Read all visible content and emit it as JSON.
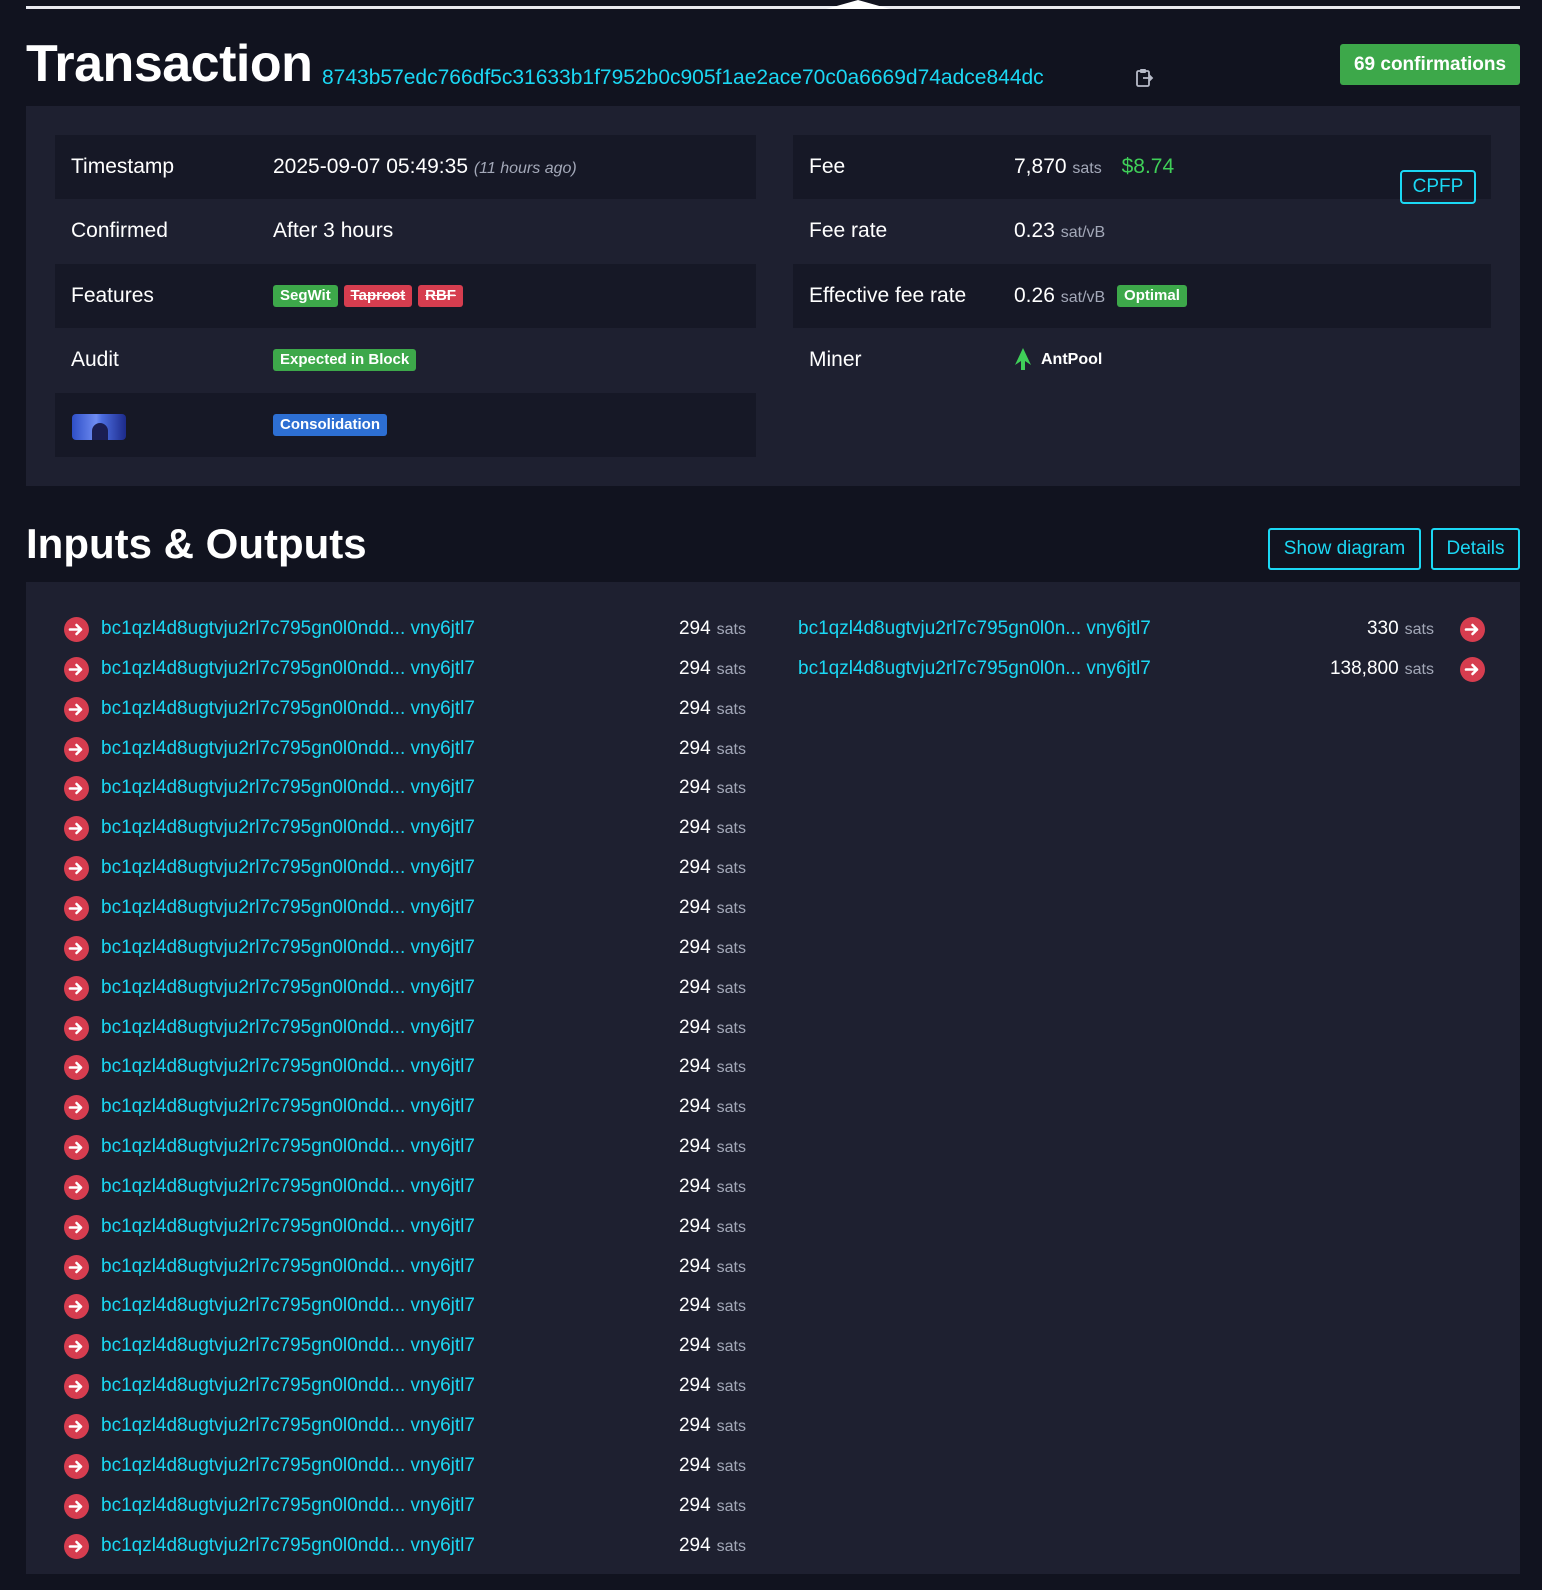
{
  "header": {
    "title": "Transaction",
    "txid": "8743b57edc766df5c31633b1f7952b0c905f1ae2ace70c0a6669d74adce844dc",
    "confirmations": "69 confirmations"
  },
  "left_details": {
    "timestamp": {
      "label": "Timestamp",
      "value": "2025-09-07 05:49:35",
      "relative": "(11 hours ago)"
    },
    "confirmed": {
      "label": "Confirmed",
      "value": "After 3 hours"
    },
    "features": {
      "label": "Features",
      "tags": [
        "SegWit",
        "Taproot",
        "RBF"
      ]
    },
    "audit": {
      "label": "Audit",
      "tag": "Expected in Block"
    },
    "classification": {
      "tag": "Consolidation"
    }
  },
  "right_details": {
    "fee": {
      "label": "Fee",
      "value": "7,870",
      "unit": "sats",
      "usd": "$8.74"
    },
    "fee_rate": {
      "label": "Fee rate",
      "value": "0.23",
      "unit": "sat/vB"
    },
    "effective_fee_rate": {
      "label": "Effective fee rate",
      "value": "0.26",
      "unit": "sat/vB",
      "tag": "Optimal",
      "button": "CPFP"
    },
    "miner": {
      "label": "Miner",
      "value": "AntPool"
    }
  },
  "io": {
    "title": "Inputs & Outputs",
    "show_diagram_label": "Show diagram",
    "details_label": "Details",
    "inputs": [
      {
        "address": "bc1qzl4d8ugtvju2rl7c795gn0l0ndd... vny6jtl7",
        "amount": "294",
        "unit": "sats"
      },
      {
        "address": "bc1qzl4d8ugtvju2rl7c795gn0l0ndd... vny6jtl7",
        "amount": "294",
        "unit": "sats"
      },
      {
        "address": "bc1qzl4d8ugtvju2rl7c795gn0l0ndd... vny6jtl7",
        "amount": "294",
        "unit": "sats"
      },
      {
        "address": "bc1qzl4d8ugtvju2rl7c795gn0l0ndd... vny6jtl7",
        "amount": "294",
        "unit": "sats"
      },
      {
        "address": "bc1qzl4d8ugtvju2rl7c795gn0l0ndd... vny6jtl7",
        "amount": "294",
        "unit": "sats"
      },
      {
        "address": "bc1qzl4d8ugtvju2rl7c795gn0l0ndd... vny6jtl7",
        "amount": "294",
        "unit": "sats"
      },
      {
        "address": "bc1qzl4d8ugtvju2rl7c795gn0l0ndd... vny6jtl7",
        "amount": "294",
        "unit": "sats"
      },
      {
        "address": "bc1qzl4d8ugtvju2rl7c795gn0l0ndd... vny6jtl7",
        "amount": "294",
        "unit": "sats"
      },
      {
        "address": "bc1qzl4d8ugtvju2rl7c795gn0l0ndd... vny6jtl7",
        "amount": "294",
        "unit": "sats"
      },
      {
        "address": "bc1qzl4d8ugtvju2rl7c795gn0l0ndd... vny6jtl7",
        "amount": "294",
        "unit": "sats"
      },
      {
        "address": "bc1qzl4d8ugtvju2rl7c795gn0l0ndd... vny6jtl7",
        "amount": "294",
        "unit": "sats"
      },
      {
        "address": "bc1qzl4d8ugtvju2rl7c795gn0l0ndd... vny6jtl7",
        "amount": "294",
        "unit": "sats"
      },
      {
        "address": "bc1qzl4d8ugtvju2rl7c795gn0l0ndd... vny6jtl7",
        "amount": "294",
        "unit": "sats"
      },
      {
        "address": "bc1qzl4d8ugtvju2rl7c795gn0l0ndd... vny6jtl7",
        "amount": "294",
        "unit": "sats"
      },
      {
        "address": "bc1qzl4d8ugtvju2rl7c795gn0l0ndd... vny6jtl7",
        "amount": "294",
        "unit": "sats"
      },
      {
        "address": "bc1qzl4d8ugtvju2rl7c795gn0l0ndd... vny6jtl7",
        "amount": "294",
        "unit": "sats"
      },
      {
        "address": "bc1qzl4d8ugtvju2rl7c795gn0l0ndd... vny6jtl7",
        "amount": "294",
        "unit": "sats"
      },
      {
        "address": "bc1qzl4d8ugtvju2rl7c795gn0l0ndd... vny6jtl7",
        "amount": "294",
        "unit": "sats"
      },
      {
        "address": "bc1qzl4d8ugtvju2rl7c795gn0l0ndd... vny6jtl7",
        "amount": "294",
        "unit": "sats"
      },
      {
        "address": "bc1qzl4d8ugtvju2rl7c795gn0l0ndd... vny6jtl7",
        "amount": "294",
        "unit": "sats"
      },
      {
        "address": "bc1qzl4d8ugtvju2rl7c795gn0l0ndd... vny6jtl7",
        "amount": "294",
        "unit": "sats"
      },
      {
        "address": "bc1qzl4d8ugtvju2rl7c795gn0l0ndd... vny6jtl7",
        "amount": "294",
        "unit": "sats"
      },
      {
        "address": "bc1qzl4d8ugtvju2rl7c795gn0l0ndd... vny6jtl7",
        "amount": "294",
        "unit": "sats"
      },
      {
        "address": "bc1qzl4d8ugtvju2rl7c795gn0l0ndd... vny6jtl7",
        "amount": "294",
        "unit": "sats"
      }
    ],
    "outputs": [
      {
        "address": "bc1qzl4d8ugtvju2rl7c795gn0l0n... vny6jtl7",
        "amount": "330",
        "unit": "sats"
      },
      {
        "address": "bc1qzl4d8ugtvju2rl7c795gn0l0n... vny6jtl7",
        "amount": "138,800",
        "unit": "sats"
      }
    ]
  },
  "colors": {
    "background": "#11131f",
    "panel": "#1e2030",
    "link": "#1bd8f4",
    "confirmations": "#3da84a",
    "red": "#d63d4f",
    "usd": "#3fcf58"
  }
}
